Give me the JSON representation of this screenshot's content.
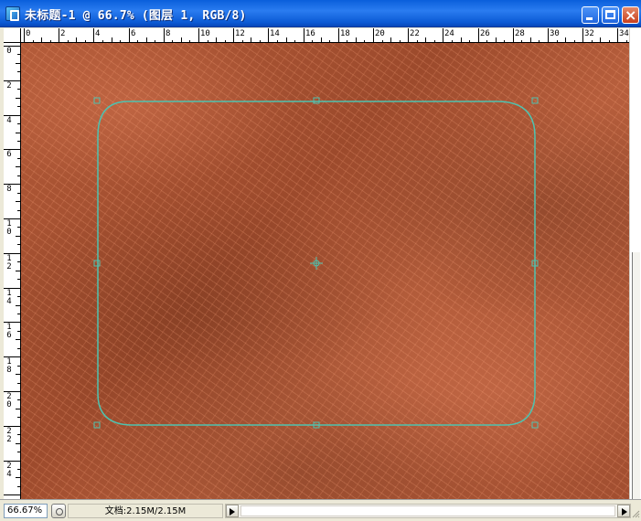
{
  "window": {
    "title": "未标题-1 @ 66.7% (图层 1, RGB/8)",
    "icon": "photoshop-document-icon",
    "controls": [
      "minimize-icon",
      "maximize-icon",
      "close-icon"
    ]
  },
  "ruler_h": [
    "0",
    "2",
    "4",
    "6",
    "8",
    "10",
    "12",
    "14",
    "16",
    "18",
    "20",
    "22",
    "24",
    "26",
    "28",
    "30",
    "32",
    "34"
  ],
  "ruler_v": [
    "0",
    "2",
    "4",
    "6",
    "8",
    "10",
    "12",
    "14",
    "16",
    "18",
    "20",
    "22",
    "24"
  ],
  "canvas": {
    "texture": "brown woven leather pattern",
    "path_color": "#4ec3b0",
    "shape": "rounded-rectangle path with anchor points",
    "center_marker": "crosshair-center-icon"
  },
  "statusbar": {
    "zoom": "66.67%",
    "doc_info": "文档:2.15M/2.15M",
    "info_button": "info-circle-icon"
  }
}
